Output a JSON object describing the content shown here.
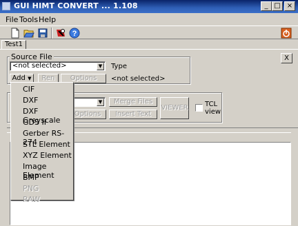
{
  "window": {
    "title": "GUI HIMT CONVERT  ... 1.108",
    "min": "_",
    "max": "□",
    "close": "×"
  },
  "menu": [
    {
      "label": "File"
    },
    {
      "label": "Tools"
    },
    {
      "label": "Help"
    }
  ],
  "tabs": [
    {
      "label": "Test1"
    }
  ],
  "panel_close": "X",
  "source_file": {
    "group_label": "Source File",
    "combo_value": "<not selected>",
    "type_label": "Type",
    "type_value": "<not selected>",
    "add_label": "Add",
    "ren_label": "Ren",
    "options_label": "Options"
  },
  "lower": {
    "options_label": "Options",
    "merge_label": "Merge Files",
    "insert_label": "Insert Text",
    "viewer_label": "VIEWER",
    "tcl_label_1": "TCL",
    "tcl_label_2": "view"
  },
  "add_menu": [
    {
      "label": "CIF",
      "enabled": true
    },
    {
      "label": "DXF",
      "enabled": true
    },
    {
      "label": "DXF Greyscale",
      "enabled": true
    },
    {
      "label": "GDS II",
      "enabled": true
    },
    {
      "label": "Gerber RS-274",
      "enabled": true
    },
    {
      "label": "STL Element",
      "enabled": true
    },
    {
      "label": "XYZ Element",
      "enabled": true
    },
    {
      "label": "Image Element",
      "enabled": true
    },
    {
      "label": "BMP",
      "enabled": true
    },
    {
      "label": "PNG",
      "enabled": false
    },
    {
      "label": "RAW",
      "enabled": false
    }
  ]
}
